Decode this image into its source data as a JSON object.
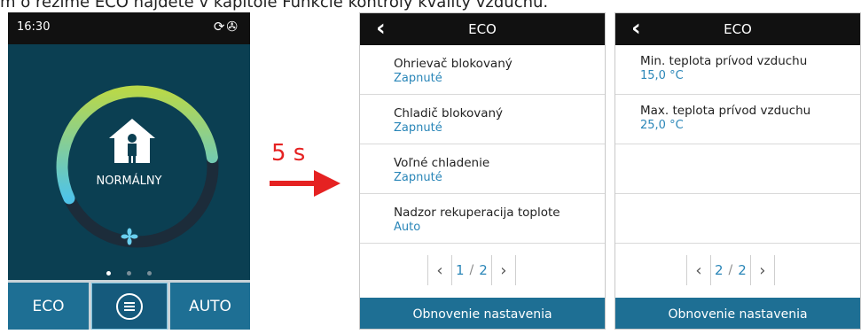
{
  "caption": "m o režime ECO nájdete v kapitole Funkcie kontroly kvality vzduchu.",
  "phone": {
    "time": "16:30",
    "status_icons": "⟳✇",
    "mode_label": "NORMÁLNY",
    "page_dots": [
      "active",
      "inactive",
      "inactive"
    ],
    "ring_progress": 0.55,
    "buttons": {
      "eco": "ECO",
      "auto": "AUTO"
    }
  },
  "transition": {
    "label": "5 s"
  },
  "panel1": {
    "title": "ECO",
    "back_icon": "‹",
    "rows": [
      {
        "label": "Ohrievač blokovaný",
        "value": "Zapnuté"
      },
      {
        "label": "Chladič blokovaný",
        "value": "Zapnuté"
      },
      {
        "label": "Voľné chladenie",
        "value": "Zapnuté"
      },
      {
        "label": "Nadzor rekuperacija toplote",
        "value": "Auto"
      }
    ],
    "pager": {
      "prev": "‹",
      "current": "1",
      "separator": "/",
      "total": "2",
      "next": "›"
    },
    "footer": "Obnovenie nastavenia"
  },
  "panel2": {
    "title": "ECO",
    "back_icon": "‹",
    "rows": [
      {
        "label": "Min. teplota prívod vzduchu",
        "value": "15,0 °C"
      },
      {
        "label": "Max. teplota prívod vzduchu",
        "value": "25,0 °C"
      },
      {
        "label": "",
        "value": ""
      },
      {
        "label": "",
        "value": ""
      }
    ],
    "pager": {
      "prev": "‹",
      "current": "2",
      "separator": "/",
      "total": "2",
      "next": "›"
    },
    "footer": "Obnovenie nastavenia"
  },
  "colors": {
    "accent": "#1e6f94",
    "value_text": "#2a86b8",
    "arrow": "#e52222",
    "screen_bg": "#0b3f52"
  }
}
